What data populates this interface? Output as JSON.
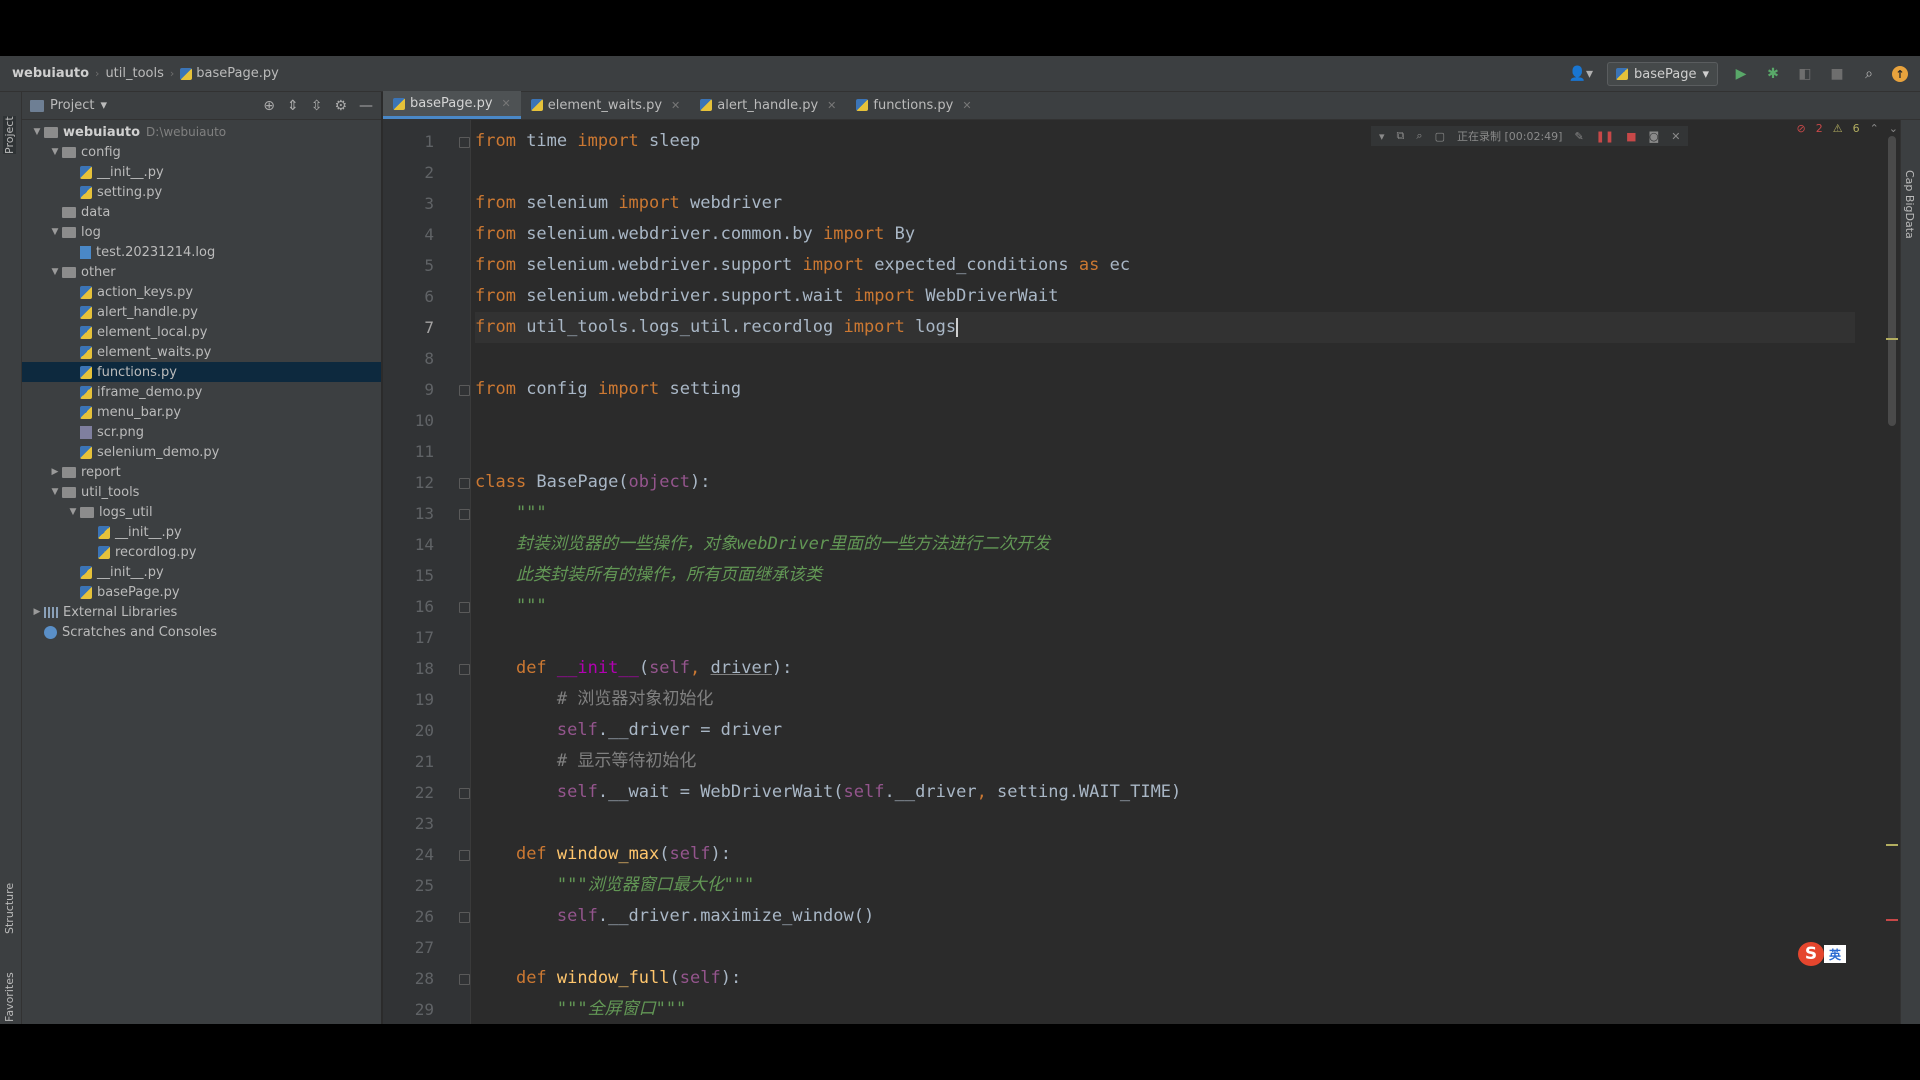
{
  "breadcrumb": [
    "webuiauto",
    "util_tools",
    "basePage.py"
  ],
  "run_config": "basePage",
  "project_panel": {
    "title": "Project",
    "tree": [
      {
        "label": "webuiauto",
        "hint": "D:\\webuiauto",
        "depth": 0,
        "kind": "folder",
        "state": "open",
        "bold": true
      },
      {
        "label": "config",
        "depth": 1,
        "kind": "folder",
        "state": "open"
      },
      {
        "label": "__init__.py",
        "depth": 2,
        "kind": "py"
      },
      {
        "label": "setting.py",
        "depth": 2,
        "kind": "py"
      },
      {
        "label": "data",
        "depth": 1,
        "kind": "folder",
        "state": "none"
      },
      {
        "label": "log",
        "depth": 1,
        "kind": "folder",
        "state": "open"
      },
      {
        "label": "test.20231214.log",
        "depth": 2,
        "kind": "log"
      },
      {
        "label": "other",
        "depth": 1,
        "kind": "folder",
        "state": "open"
      },
      {
        "label": "action_keys.py",
        "depth": 2,
        "kind": "py"
      },
      {
        "label": "alert_handle.py",
        "depth": 2,
        "kind": "py"
      },
      {
        "label": "element_local.py",
        "depth": 2,
        "kind": "py"
      },
      {
        "label": "element_waits.py",
        "depth": 2,
        "kind": "py"
      },
      {
        "label": "functions.py",
        "depth": 2,
        "kind": "py",
        "selected": true
      },
      {
        "label": "iframe_demo.py",
        "depth": 2,
        "kind": "py"
      },
      {
        "label": "menu_bar.py",
        "depth": 2,
        "kind": "py"
      },
      {
        "label": "scr.png",
        "depth": 2,
        "kind": "img"
      },
      {
        "label": "selenium_demo.py",
        "depth": 2,
        "kind": "py"
      },
      {
        "label": "report",
        "depth": 1,
        "kind": "folder",
        "state": "closed"
      },
      {
        "label": "util_tools",
        "depth": 1,
        "kind": "folder",
        "state": "open"
      },
      {
        "label": "logs_util",
        "depth": 2,
        "kind": "folder",
        "state": "open"
      },
      {
        "label": "__init__.py",
        "depth": 3,
        "kind": "py"
      },
      {
        "label": "recordlog.py",
        "depth": 3,
        "kind": "py"
      },
      {
        "label": "__init__.py",
        "depth": 2,
        "kind": "py"
      },
      {
        "label": "basePage.py",
        "depth": 2,
        "kind": "py"
      },
      {
        "label": "External Libraries",
        "depth": 0,
        "kind": "lib",
        "state": "closed"
      },
      {
        "label": "Scratches and Consoles",
        "depth": 0,
        "kind": "scratch",
        "state": "none"
      }
    ]
  },
  "tool_stripes": {
    "project": "Project",
    "structure": "Structure",
    "favorites": "Favorites",
    "right": "Cap BigData"
  },
  "tabs": [
    {
      "label": "basePage.py",
      "active": true
    },
    {
      "label": "element_waits.py"
    },
    {
      "label": "alert_handle.py"
    },
    {
      "label": "functions.py"
    }
  ],
  "recording": {
    "label": "正在录制 [00:02:49]"
  },
  "inspections": {
    "errors": "2",
    "warnings": "6"
  },
  "current_line": 7,
  "code_lines": [
    [
      [
        "kw",
        "from"
      ],
      [
        "t",
        " time "
      ],
      [
        "kw",
        "import"
      ],
      [
        "t",
        " sleep"
      ]
    ],
    [],
    [
      [
        "kw",
        "from"
      ],
      [
        "t",
        " selenium "
      ],
      [
        "kw",
        "import"
      ],
      [
        "t",
        " webdriver"
      ]
    ],
    [
      [
        "kw",
        "from"
      ],
      [
        "t",
        " selenium.webdriver.common.by "
      ],
      [
        "kw",
        "import"
      ],
      [
        "t",
        " By"
      ]
    ],
    [
      [
        "kw",
        "from"
      ],
      [
        "t",
        " selenium.webdriver.support "
      ],
      [
        "kw",
        "import"
      ],
      [
        "t",
        " expected_conditions "
      ],
      [
        "kw",
        "as"
      ],
      [
        "t",
        " ec"
      ]
    ],
    [
      [
        "kw",
        "from"
      ],
      [
        "t",
        " selenium.webdriver.support.wait "
      ],
      [
        "kw",
        "import"
      ],
      [
        "t",
        " WebDriverWait"
      ]
    ],
    [
      [
        "kw",
        "from"
      ],
      [
        "t",
        " util_tools.logs_util.recordlog "
      ],
      [
        "kw",
        "import"
      ],
      [
        "t",
        " logs"
      ],
      [
        "caret",
        ""
      ]
    ],
    [],
    [
      [
        "kw",
        "from"
      ],
      [
        "t",
        " config "
      ],
      [
        "kw",
        "import"
      ],
      [
        "t",
        " setting"
      ]
    ],
    [],
    [],
    [
      [
        "kw",
        "class"
      ],
      [
        "t",
        " BasePage("
      ],
      [
        "self",
        "object"
      ],
      [
        "t",
        "):"
      ]
    ],
    [
      [
        "doc",
        "    \"\"\""
      ]
    ],
    [
      [
        "doc",
        "    封装浏览器的一些操作，对象webDriver里面的一些方法进行二次开发"
      ]
    ],
    [
      [
        "doc",
        "    此类封装所有的操作，所有页面继承该类"
      ]
    ],
    [
      [
        "doc",
        "    \"\"\""
      ]
    ],
    [],
    [
      [
        "t",
        "    "
      ],
      [
        "kw",
        "def"
      ],
      [
        "t",
        " "
      ],
      [
        "dunder",
        "__init__"
      ],
      [
        "t",
        "("
      ],
      [
        "self",
        "self"
      ],
      [
        "kw",
        ","
      ],
      [
        "t",
        " "
      ],
      [
        "under",
        "driver"
      ],
      [
        "t",
        "):"
      ]
    ],
    [
      [
        "cmt",
        "        # 浏览器对象初始化"
      ]
    ],
    [
      [
        "t",
        "        "
      ],
      [
        "self",
        "self"
      ],
      [
        "t",
        ".__driver = driver"
      ]
    ],
    [
      [
        "cmt",
        "        # 显示等待初始化"
      ]
    ],
    [
      [
        "t",
        "        "
      ],
      [
        "self",
        "self"
      ],
      [
        "t",
        ".__wait = WebDriverWait("
      ],
      [
        "self",
        "self"
      ],
      [
        "t",
        ".__driver"
      ],
      [
        "kw",
        ","
      ],
      [
        "t",
        " setting.WAIT_TIME)"
      ]
    ],
    [],
    [
      [
        "t",
        "    "
      ],
      [
        "kw",
        "def"
      ],
      [
        "t",
        " "
      ],
      [
        "fn",
        "window_max"
      ],
      [
        "t",
        "("
      ],
      [
        "self",
        "self"
      ],
      [
        "t",
        "):"
      ]
    ],
    [
      [
        "doc",
        "        \"\"\"浏览器窗口最大化\"\"\""
      ]
    ],
    [
      [
        "t",
        "        "
      ],
      [
        "self",
        "self"
      ],
      [
        "t",
        ".__driver.maximize_window()"
      ]
    ],
    [],
    [
      [
        "t",
        "    "
      ],
      [
        "kw",
        "def"
      ],
      [
        "t",
        " "
      ],
      [
        "fn",
        "window_full"
      ],
      [
        "t",
        "("
      ],
      [
        "self",
        "self"
      ],
      [
        "t",
        "):"
      ]
    ],
    [
      [
        "doc",
        "        \"\"\"全屏窗口\"\"\""
      ]
    ]
  ],
  "colors": {
    "keyword": "#cc7832",
    "self": "#94558d",
    "docstring": "#629755",
    "comment": "#808080",
    "function": "#ffc66d",
    "selection": "#0d293e",
    "accent": "#4a88c7"
  }
}
